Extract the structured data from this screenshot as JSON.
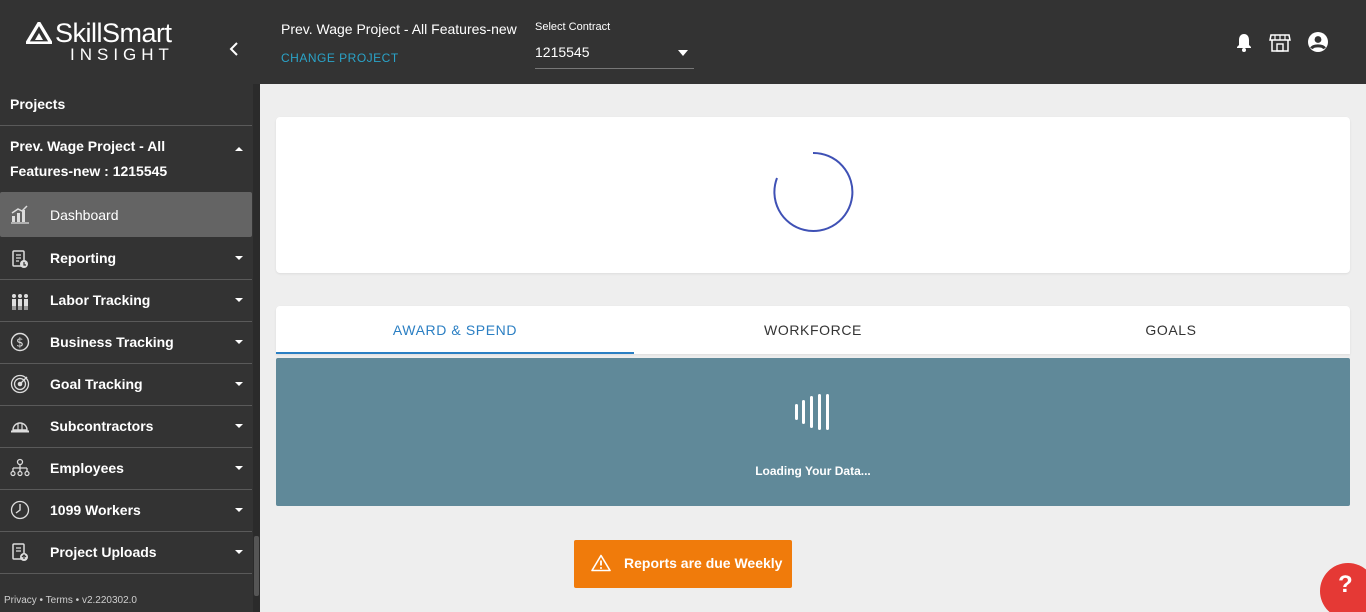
{
  "brand": {
    "name": "SkillSmart",
    "tagline": "INSIGHT"
  },
  "sidebar": {
    "section_label": "Projects",
    "project_name": "Prev. Wage Project - All Features-new : 1215545",
    "items": [
      {
        "label": "Dashboard",
        "icon": "dashboard-chart-icon",
        "active": true
      },
      {
        "label": "Reporting",
        "icon": "report-icon"
      },
      {
        "label": "Labor Tracking",
        "icon": "people-group-icon"
      },
      {
        "label": "Business Tracking",
        "icon": "dollar-circle-icon"
      },
      {
        "label": "Goal Tracking",
        "icon": "target-icon"
      },
      {
        "label": "Subcontractors",
        "icon": "hardhat-icon"
      },
      {
        "label": "Employees",
        "icon": "org-chart-icon"
      },
      {
        "label": "1099 Workers",
        "icon": "clock-icon"
      },
      {
        "label": "Project Uploads",
        "icon": "upload-doc-icon"
      }
    ],
    "footer": "Privacy • Terms • v2.220302.0"
  },
  "header": {
    "project_title": "Prev. Wage Project - All Features-new",
    "change_project": "CHANGE PROJECT",
    "contract_label": "Select Contract",
    "contract_value": "1215545"
  },
  "tabs": [
    {
      "label": "AWARD & SPEND",
      "active": true
    },
    {
      "label": "WORKFORCE"
    },
    {
      "label": "GOALS"
    }
  ],
  "loading": {
    "text": "Loading Your Data..."
  },
  "banner": {
    "text": "Reports are due Weekly"
  },
  "help": {
    "label": "?"
  },
  "colors": {
    "sidebar_bg": "#333333",
    "accent_blue": "#2b7fc3",
    "link_teal": "#2aa3c8",
    "panel_bg": "#608999",
    "banner_orange": "#f07b0b",
    "help_red": "#e53935"
  }
}
